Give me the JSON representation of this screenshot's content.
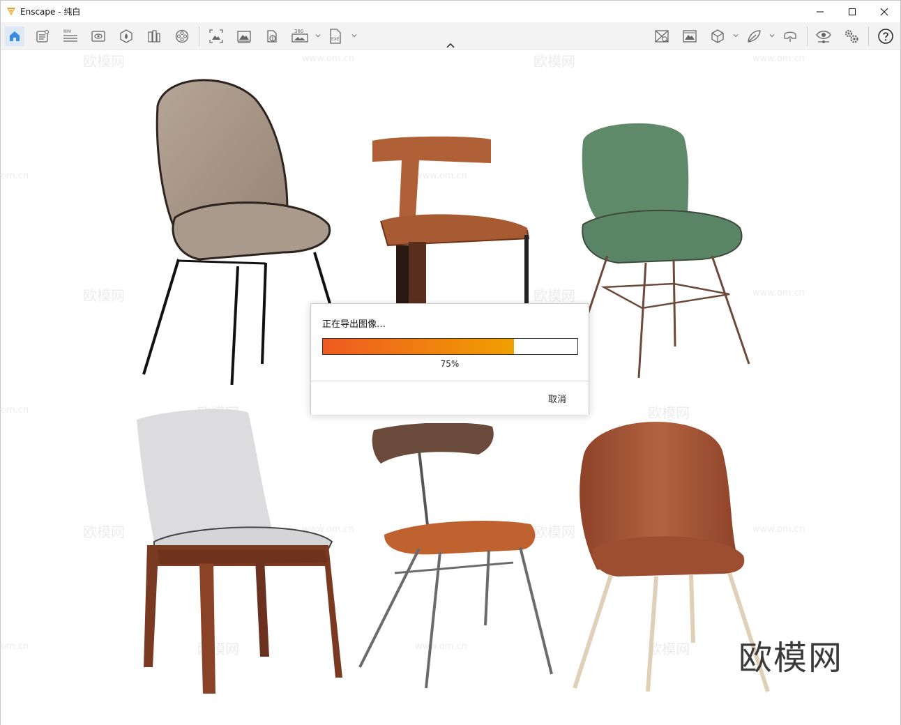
{
  "window": {
    "app_name": "Enscape",
    "title_separator": " - ",
    "document_name": "纯白"
  },
  "toolbar": {
    "left_icons": [
      "home-icon",
      "view-management-icon",
      "bim-icon",
      "visual-settings-icon",
      "asset-library-icon",
      "batch-render-icon",
      "video-editor-icon",
      "screenshot-icon",
      "panorama-icon",
      "web-standalone-icon",
      "export-360-icon",
      "export-exe-icon"
    ],
    "bim_label": "BIM",
    "pano_label": "360",
    "exe_label": "EXE",
    "right_icons": [
      "sync-selection-icon",
      "synchronize-views-icon",
      "cube-view-icon",
      "material-editor-icon",
      "vr-headset-icon",
      "live-update-icon",
      "settings-icon",
      "help-icon"
    ]
  },
  "export_dialog": {
    "title": "正在导出图像…",
    "progress_value": 0.75,
    "progress_text": "75%",
    "cancel_label": "取消",
    "progress_colors": {
      "start": "#ef5a22",
      "end": "#f0a000"
    }
  },
  "watermark": {
    "brand_text": "欧模网",
    "domain_text": "www.om.cn",
    "domain_fragment": "om.cn"
  },
  "colors": {
    "accent": "#2f7fd6",
    "chair_beige": "#a79585",
    "chair_orange_leather": "#b06036",
    "chair_green": "#5f8a6a",
    "chair_white_fabric": "#dcdcde",
    "chair_walnut": "#7a3a22",
    "chair_brown_leather": "#a6573a"
  }
}
